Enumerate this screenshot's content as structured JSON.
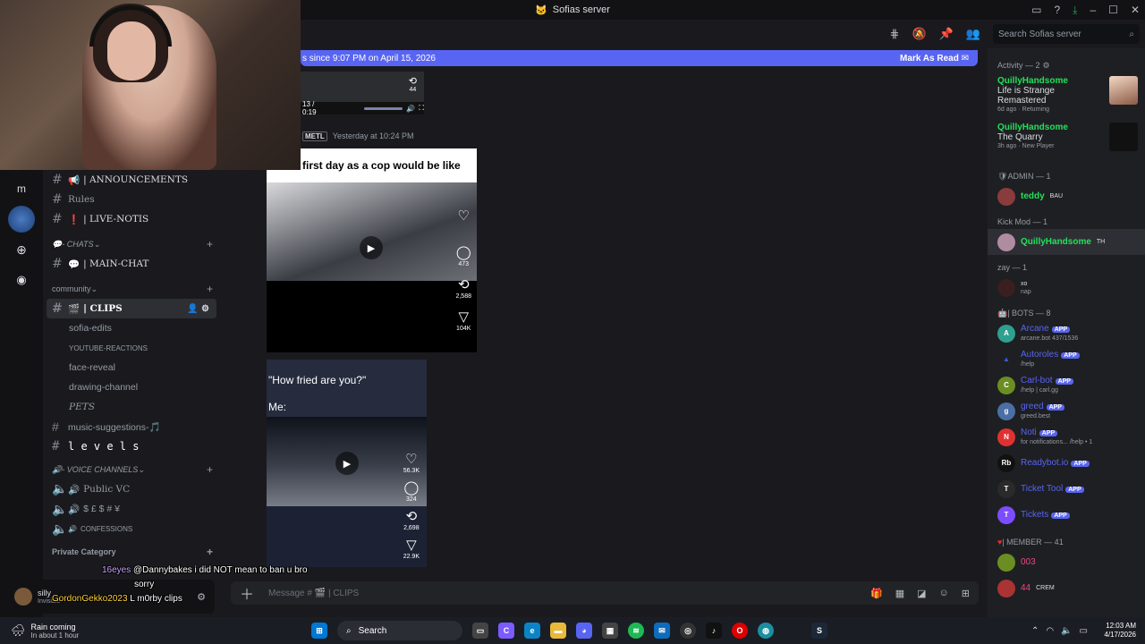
{
  "window": {
    "title": "Sofias server"
  },
  "search": {
    "placeholder": "Search Sofias server"
  },
  "banner": {
    "text": "s since 9:07 PM on April 15, 2026",
    "action": "Mark As Read"
  },
  "video_top": {
    "time": "13 / 0:19",
    "likes": "44"
  },
  "message": {
    "author": "METL",
    "timestamp": "Yesterday at 10:24 PM"
  },
  "video1": {
    "caption": "first day as a cop would be like",
    "comments": "473",
    "reposts": "2,588",
    "shares": "104K"
  },
  "video2": {
    "caption_line1": "\"How fried are you?\"",
    "caption_line2": "Me:",
    "likes": "56.3K",
    "comments": "324",
    "reposts": "2,698",
    "shares": "22.9K"
  },
  "guilds": [
    {
      "letter": "m"
    }
  ],
  "channels": {
    "items": [
      {
        "name": "| ANNOUNCEMENTS",
        "emoji": "📢",
        "style": "caps"
      },
      {
        "name": "Rules",
        "emoji": "",
        "style": "serif"
      },
      {
        "name": "| LIVE-NOTIS",
        "emoji": "❗",
        "style": "caps"
      }
    ],
    "cat_chats": "- CHATS",
    "main_chat": "| MAIN-CHAT",
    "cat_community": "community",
    "clips": "| CLIPS",
    "community_items": [
      "sofia-edits",
      "YOUTUBE-REACTIONS",
      "face-reveal",
      "drawing-channel",
      "PETS",
      "music-suggestions-🎵",
      "l e v e l s"
    ],
    "cat_voice": "- VOICE CHANNELS",
    "voice_items": [
      "Public VC",
      "$ £ $ # ¥",
      "CONFESSIONS"
    ],
    "cat_private": "Private Category"
  },
  "members": {
    "activity_header": "Activity — 2",
    "activities": [
      {
        "name": "QuillyHandsome",
        "title": "Life is Strange Remastered",
        "meta": "6d ago",
        "status": "Returning"
      },
      {
        "name": "QuillyHandsome",
        "title": "The Quarry",
        "meta": "3h ago",
        "status": "New Player"
      }
    ],
    "admin_header": "ADMIN — 1",
    "admin": [
      {
        "name": "teddy",
        "tag": "BAU"
      }
    ],
    "kickmod_header": "Kick Mod — 1",
    "kickmod": [
      {
        "name": "QuillyHandsome",
        "tag": "TH"
      }
    ],
    "zay_header": "zay — 1",
    "zay": [
      {
        "name": "xo",
        "sub": "nap"
      }
    ],
    "bots_header": "| BOTS — 8",
    "bots": [
      {
        "name": "Arcane",
        "sub": "arcane.bot 437/1536",
        "color": "#2ea08f",
        "letter": "A"
      },
      {
        "name": "Autoroles",
        "sub": "/help",
        "color": "#3b5bdb",
        "letter": "▲"
      },
      {
        "name": "Carl-bot",
        "sub": "/help | carl.gg",
        "color": "#6b8e23",
        "letter": "C"
      },
      {
        "name": "greed",
        "sub": "greed.best",
        "color": "#4a6fa5",
        "letter": "g"
      },
      {
        "name": "Noti",
        "sub": "for notifications... /help • 1",
        "color": "#e03131",
        "letter": "N"
      },
      {
        "name": "Readybot.io",
        "sub": "",
        "color": "#111111",
        "letter": "Rb"
      },
      {
        "name": "Ticket Tool",
        "sub": "",
        "color": "#2a2a2a",
        "letter": "T"
      },
      {
        "name": "Tickets",
        "sub": "",
        "color": "#7c4dff",
        "letter": "T"
      }
    ],
    "app_label": "APP",
    "member_header": "| MEMBER — 41",
    "member_list": [
      {
        "name": "003"
      },
      {
        "name": "44",
        "tag": "CREM"
      }
    ]
  },
  "composer": {
    "placeholder": "Message #",
    "channel": "| CLIPS"
  },
  "user": {
    "name": "silly",
    "status": "Invisible"
  },
  "overlay_chat": [
    {
      "user": "16eyes",
      "text": "@Dannybakes i did NOT mean to ban u bro"
    },
    {
      "user": "",
      "text": "sorry"
    },
    {
      "user": "GordonGekko2023",
      "text": "L m0rby clips"
    }
  ],
  "taskbar": {
    "weather_title": "Rain coming",
    "weather_sub": "In about 1 hour",
    "search": "Search",
    "time": "12:03 AM",
    "date": "4/17/2026"
  },
  "colors": {
    "accent": "#5865f2",
    "green": "#23e05b"
  }
}
